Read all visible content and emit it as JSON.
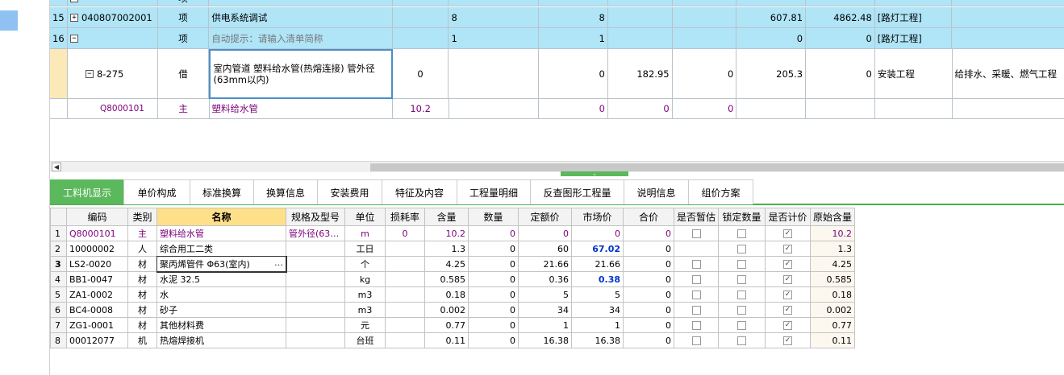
{
  "top_rows": [
    {
      "num": "",
      "code": "",
      "type": "项",
      "name": "",
      "qty_expr": "",
      "qty": "",
      "v1": "",
      "v2": "",
      "v3": "",
      "v4": "",
      "v5": "",
      "major": "",
      "extra": ""
    },
    {
      "num": "15",
      "code": "040807002001",
      "type": "项",
      "name": "供电系统调试",
      "qty_expr": "8",
      "qty": "8",
      "v1": "",
      "v2": "",
      "v3": "607.81",
      "v4": "4862.48",
      "major": "[路灯工程]",
      "extra": ""
    },
    {
      "num": "16",
      "code": "",
      "type": "项",
      "name": "自动提示：请输入清单简称",
      "qty_expr": "1",
      "qty": "1",
      "v1": "",
      "v2": "",
      "v3": "0",
      "v4": "0",
      "major": "[路灯工程]",
      "extra": ""
    },
    {
      "num": "",
      "code": "8-275",
      "type": "借",
      "name": "室内管道 塑料给水管(热熔连接) 管外径(63mm以内)",
      "qty_expr": "0",
      "qty": "0",
      "v1": "182.95",
      "v2": "0",
      "v3": "205.3",
      "v4": "0",
      "major": "安装工程",
      "extra": "给排水、采暖、燃气工程"
    },
    {
      "num": "",
      "code": "Q8000101",
      "type": "主",
      "name": "塑料给水管",
      "qty_expr": "10.2",
      "qty": "0",
      "v1": "0",
      "v2": "0",
      "v3": "",
      "v4": "",
      "major": "",
      "extra": ""
    }
  ],
  "tabs": [
    "工料机显示",
    "单价构成",
    "标准换算",
    "换算信息",
    "安装费用",
    "特征及内容",
    "工程量明细",
    "反查图形工程量",
    "说明信息",
    "组价方案"
  ],
  "headers": [
    "",
    "编码",
    "类别",
    "名称",
    "规格及型号",
    "单位",
    "损耗率",
    "含量",
    "数量",
    "定额价",
    "市场价",
    "合价",
    "是否暂估",
    "锁定数量",
    "是否计价",
    "原始含量"
  ],
  "rows": [
    {
      "n": "1",
      "code": "Q8000101",
      "cat": "主",
      "name": "塑料给水管",
      "spec": "管外径(63…",
      "unit": "m",
      "loss": "0",
      "content": "10.2",
      "amount": "0",
      "quota": "0",
      "market": "0",
      "total": "0",
      "est": false,
      "lock": false,
      "price": true,
      "orig": "10.2"
    },
    {
      "n": "2",
      "code": "10000002",
      "cat": "人",
      "name": "综合用工二类",
      "spec": "",
      "unit": "工日",
      "loss": "",
      "content": "1.3",
      "amount": "0",
      "quota": "60",
      "market": "67.02",
      "total": "0",
      "est": null,
      "lock": false,
      "price": true,
      "orig": "1.3"
    },
    {
      "n": "3",
      "code": "LS2-0020",
      "cat": "材",
      "name": "聚丙烯管件 Φ63(室内)",
      "spec": "",
      "unit": "个",
      "loss": "",
      "content": "4.25",
      "amount": "0",
      "quota": "21.66",
      "market": "21.66",
      "total": "0",
      "est": false,
      "lock": false,
      "price": true,
      "orig": "4.25"
    },
    {
      "n": "4",
      "code": "BB1-0047",
      "cat": "材",
      "name": "水泥 32.5",
      "spec": "",
      "unit": "kg",
      "loss": "",
      "content": "0.585",
      "amount": "0",
      "quota": "0.36",
      "market": "0.38",
      "total": "0",
      "est": false,
      "lock": false,
      "price": true,
      "orig": "0.585"
    },
    {
      "n": "5",
      "code": "ZA1-0002",
      "cat": "材",
      "name": "水",
      "spec": "",
      "unit": "m3",
      "loss": "",
      "content": "0.18",
      "amount": "0",
      "quota": "5",
      "market": "5",
      "total": "0",
      "est": false,
      "lock": false,
      "price": true,
      "orig": "0.18"
    },
    {
      "n": "6",
      "code": "BC4-0008",
      "cat": "材",
      "name": "砂子",
      "spec": "",
      "unit": "m3",
      "loss": "",
      "content": "0.002",
      "amount": "0",
      "quota": "34",
      "market": "34",
      "total": "0",
      "est": false,
      "lock": false,
      "price": true,
      "orig": "0.002"
    },
    {
      "n": "7",
      "code": "ZG1-0001",
      "cat": "材",
      "name": "其他材料费",
      "spec": "",
      "unit": "元",
      "loss": "",
      "content": "0.77",
      "amount": "0",
      "quota": "1",
      "market": "1",
      "total": "0",
      "est": false,
      "lock": false,
      "price": true,
      "orig": "0.77"
    },
    {
      "n": "8",
      "code": "00012077",
      "cat": "机",
      "name": "热熔焊接机",
      "spec": "",
      "unit": "台班",
      "loss": "",
      "content": "0.11",
      "amount": "0",
      "quota": "16.38",
      "market": "16.38",
      "total": "0",
      "est": false,
      "lock": false,
      "price": true,
      "orig": "0.11"
    }
  ],
  "icons": {
    "expand": "+",
    "collapse": "−",
    "check": "✓",
    "ellipsis": "…",
    "scroll_left": "◀",
    "splitter": "⌄"
  }
}
